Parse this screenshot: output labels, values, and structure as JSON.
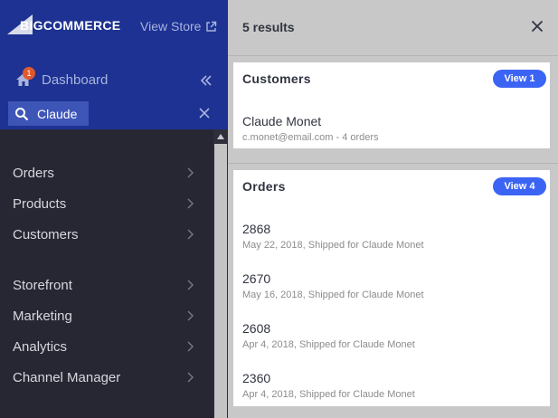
{
  "brand": {
    "logo_text": "BIGCOMMERCE"
  },
  "header": {
    "view_store_label": "View Store"
  },
  "dashboard": {
    "label": "Dashboard",
    "badge_count": "1"
  },
  "search": {
    "value": "Claude",
    "placeholder": ""
  },
  "nav": {
    "items": [
      {
        "label": "Orders"
      },
      {
        "label": "Products"
      },
      {
        "label": "Customers"
      },
      {
        "label": "Storefront"
      },
      {
        "label": "Marketing"
      },
      {
        "label": "Analytics"
      },
      {
        "label": "Channel Manager"
      }
    ]
  },
  "results": {
    "count_label": "5 results",
    "customers": {
      "title": "Customers",
      "view_label": "View 1",
      "items": [
        {
          "name": "Claude Monet",
          "detail": "c.monet@email.com - 4 orders"
        }
      ]
    },
    "orders": {
      "title": "Orders",
      "view_label": "View 4",
      "items": [
        {
          "number": "2868",
          "detail": "May 22, 2018, Shipped for Claude Monet"
        },
        {
          "number": "2670",
          "detail": "May 16, 2018, Shipped for Claude Monet"
        },
        {
          "number": "2608",
          "detail": "Apr 4, 2018, Shipped for Claude Monet"
        },
        {
          "number": "2360",
          "detail": "Apr 4, 2018, Shipped for Claude Monet"
        }
      ]
    }
  },
  "colors": {
    "sidebar_top": "#1d3292",
    "sidebar_bg": "#272734",
    "accent_button": "#3c64f4",
    "badge": "#e0592d"
  },
  "icons": [
    "external-link-icon",
    "home-icon",
    "double-chevron-left-icon",
    "search-icon",
    "close-icon",
    "chevron-right-icon"
  ]
}
